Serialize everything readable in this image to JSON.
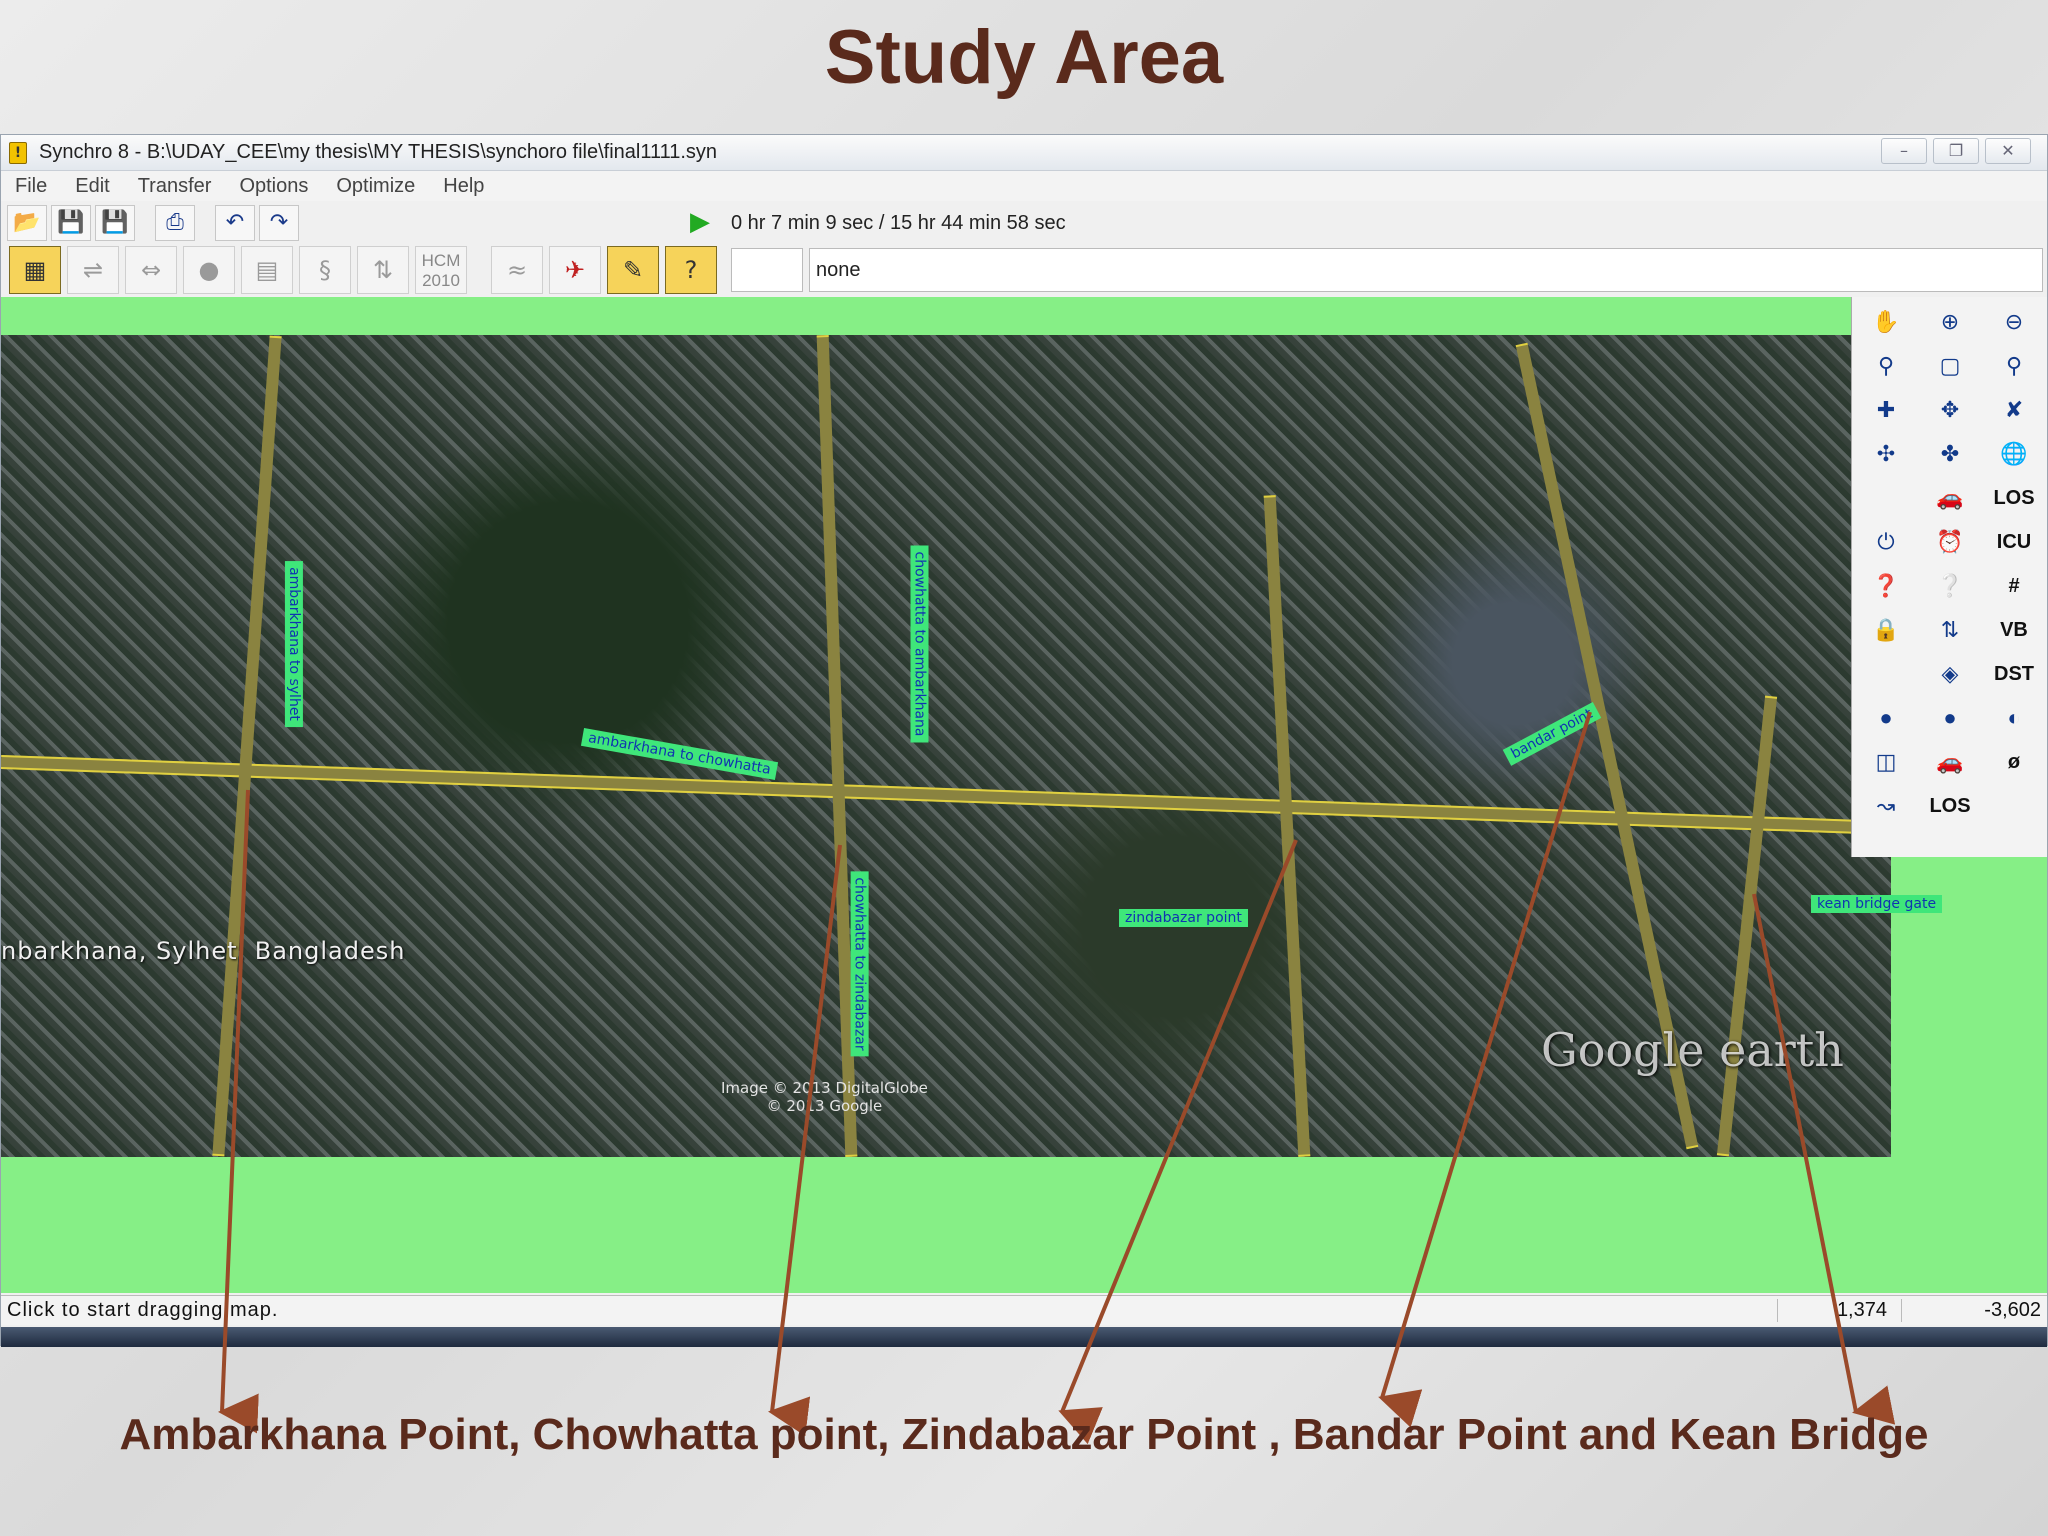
{
  "slide": {
    "title": "Study Area",
    "caption": "Ambarkhana Point, Chowhatta point, Zindabazar Point , Bandar Point and Kean Bridge"
  },
  "window": {
    "title": "Synchro 8 - B:\\UDAY_CEE\\my thesis\\MY THESIS\\synchoro file\\final1111.syn",
    "controls": [
      "–",
      "❐",
      "✕"
    ]
  },
  "menu": [
    "File",
    "Edit",
    "Transfer",
    "Options",
    "Optimize",
    "Help"
  ],
  "toolbar": {
    "time": "0 hr  7 min  9 sec /  15 hr 44 min 58 sec",
    "selection": "none",
    "hcm_label": "HCM\n2010"
  },
  "map": {
    "place_label": "nbarkhana, Sylhet, Bangladesh",
    "watermark": "Google earth",
    "imagery_credit": "Image © 2013 DigitalGlobe\n© 2013 Google",
    "road_labels": [
      "ambarkhana to chowhatta",
      "chowhatta to ambarkhana",
      "zindabazar point",
      "chowhatta to zindabazar",
      "ambarkhana to sylhet",
      "bandar point",
      "kean bridge gate"
    ]
  },
  "palette": {
    "los": "LOS",
    "icu": "ICU",
    "vb": "VB",
    "dst": "DST",
    "phi": "ø",
    "hash": "#"
  },
  "status": {
    "message": "Click to start dragging map.",
    "x": "1,374",
    "y": "-3,602"
  },
  "colors": {
    "canvas_bg": "#86ef86",
    "title_color": "#5a2a1c",
    "arrow_color": "#9a4a2a"
  }
}
